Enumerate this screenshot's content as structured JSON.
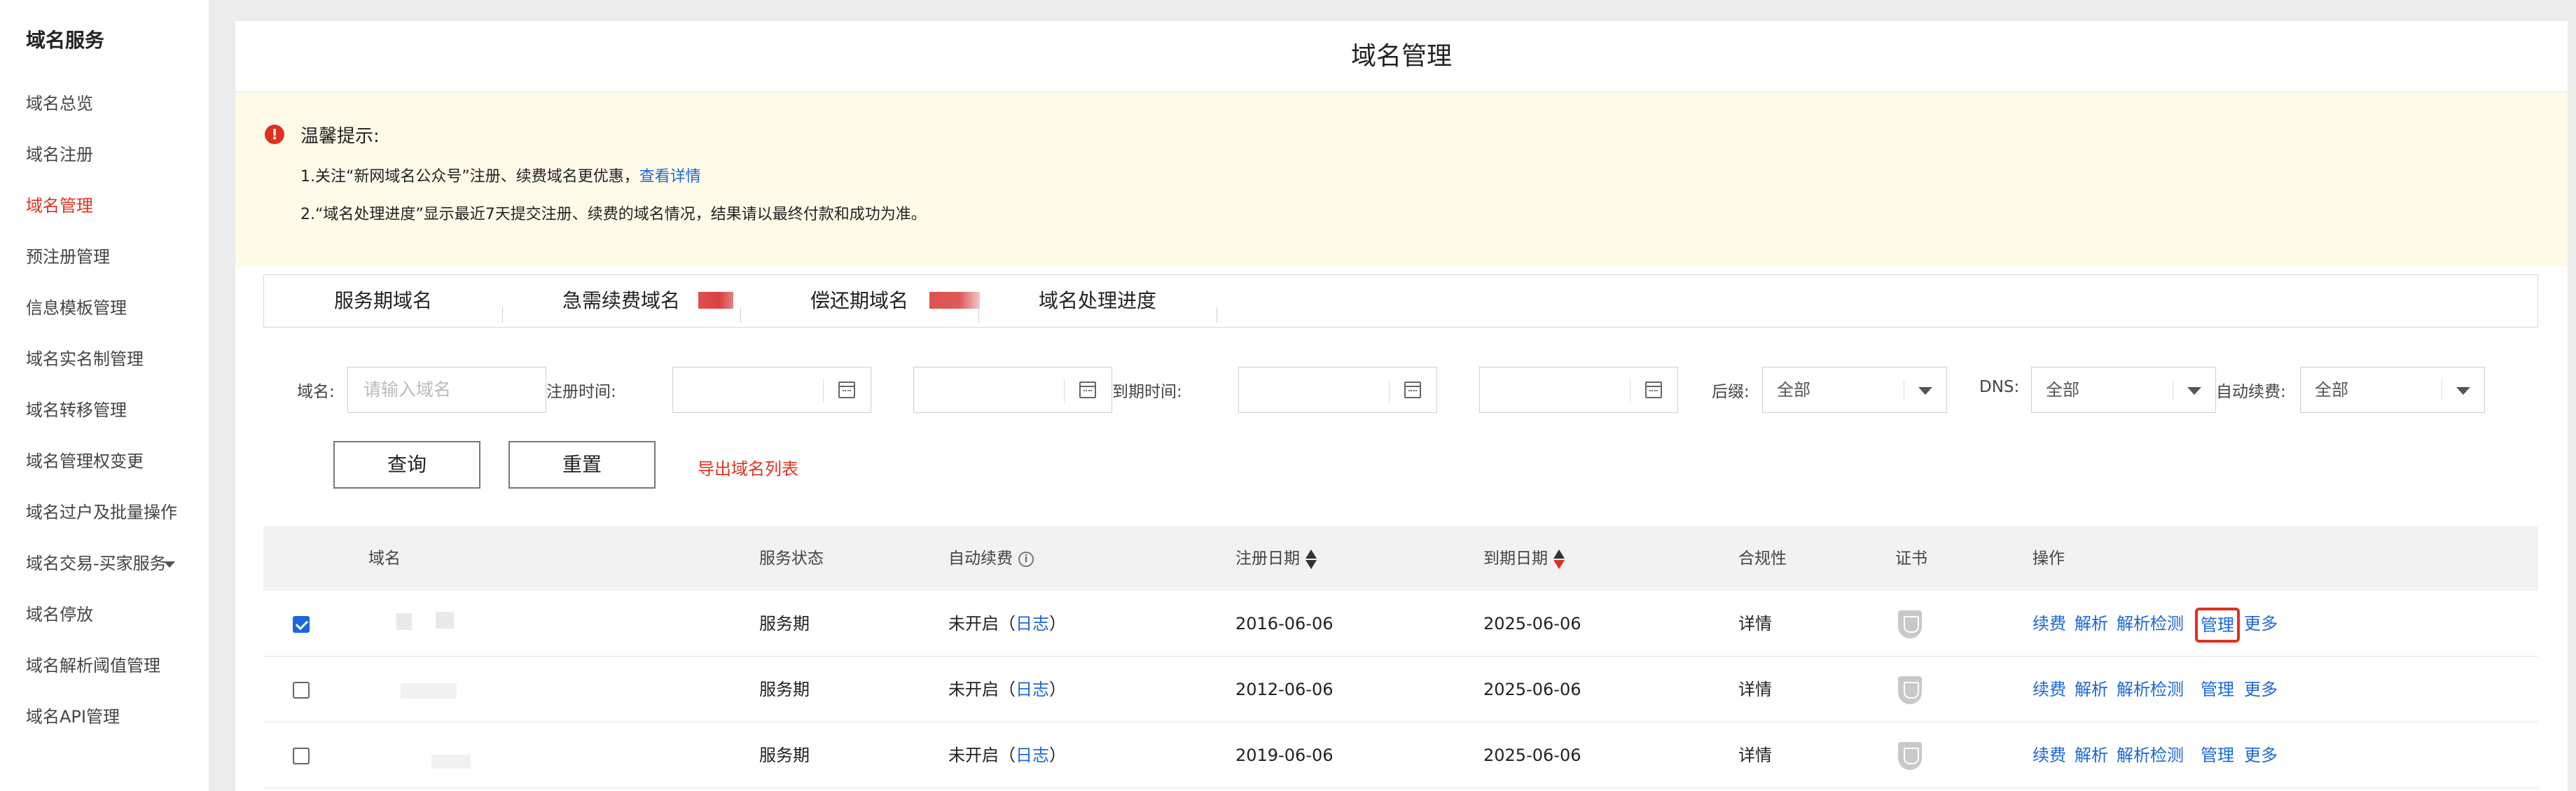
{
  "sidebar": {
    "title": "域名服务",
    "items": [
      {
        "label": "域名总览"
      },
      {
        "label": "域名注册"
      },
      {
        "label": "域名管理"
      },
      {
        "label": "预注册管理"
      },
      {
        "label": "信息模板管理"
      },
      {
        "label": "域名实名制管理"
      },
      {
        "label": "域名转移管理"
      },
      {
        "label": "域名管理权变更"
      },
      {
        "label": "域名过户及批量操作"
      },
      {
        "label": "域名交易-买家服务"
      },
      {
        "label": "域名停放"
      },
      {
        "label": "域名解析阈值管理"
      },
      {
        "label": "域名API管理"
      }
    ],
    "active_index": 2
  },
  "page": {
    "title": "域名管理"
  },
  "notice": {
    "title": "温馨提示:",
    "line1": "1.关注“新网域名公众号”注册、续费域名更优惠，",
    "line1_link": "查看详情",
    "line2": "2.“域名处理进度”显示最近7天提交注册、续费的域名情况，结果请以最终付款和成功为准。"
  },
  "tabs": [
    {
      "label": "服务期域名"
    },
    {
      "label": "急需续费域名"
    },
    {
      "label": "偿还期域名"
    },
    {
      "label": "域名处理进度"
    }
  ],
  "filters": {
    "domain_label": "域名:",
    "domain_placeholder": "请输入域名",
    "reg_time_label": "注册时间:",
    "exp_time_label": "到期时间:",
    "suffix_label": "后缀:",
    "suffix_value": "全部",
    "dns_label": "DNS:",
    "dns_value": "全部",
    "autorenew_label": "自动续费:",
    "autorenew_value": "全部",
    "query_button": "查询",
    "reset_button": "重置",
    "export_link": "导出域名列表"
  },
  "table": {
    "headers": {
      "domain": "域名",
      "status": "服务状态",
      "autorenew": "自动续费",
      "reg_date": "注册日期",
      "exp_date": "到期日期",
      "compliance": "合规性",
      "cert": "证书",
      "ops": "操作"
    },
    "rows": [
      {
        "checked": true,
        "status": "服务期",
        "autorenew": "未开启（",
        "log": "日志",
        "close": "）",
        "reg_date": "2016-06-06",
        "exp_date": "2025-06-06",
        "compliance": "详情"
      },
      {
        "checked": false,
        "status": "服务期",
        "autorenew": "未开启（",
        "log": "日志",
        "close": "）",
        "reg_date": "2012-06-06",
        "exp_date": "2025-06-06",
        "compliance": "详情"
      },
      {
        "checked": false,
        "status": "服务期",
        "autorenew": "未开启（",
        "log": "日志",
        "close": "）",
        "reg_date": "2019-06-06",
        "exp_date": "2025-06-06",
        "compliance": "详情"
      }
    ],
    "ops": [
      "续费",
      "解析",
      "解析检测",
      "管理",
      "更多"
    ]
  },
  "colors": {
    "accent_red": "#e0301e",
    "link_blue": "#1b67d8",
    "notice_bg": "#fffbe8"
  }
}
